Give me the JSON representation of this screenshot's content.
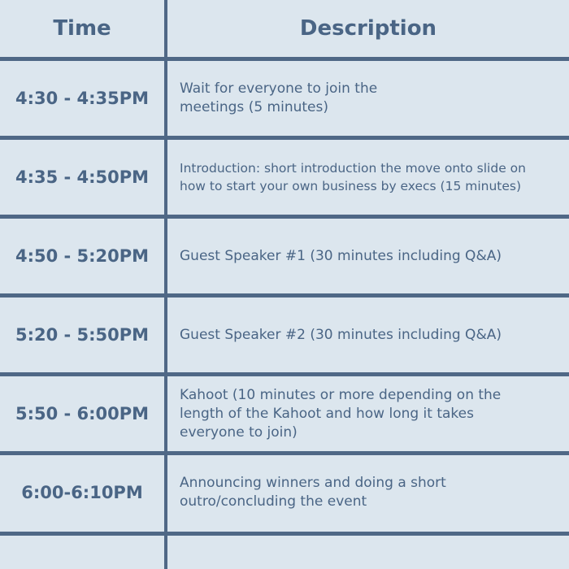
{
  "header": {
    "time_label": "Time",
    "description_label": "Description"
  },
  "rows": [
    {
      "time": "4:30 - 4:35PM",
      "description_lines": [
        "Wait for everyone to join the",
        "meetings (5 minutes)"
      ]
    },
    {
      "time": "4:35 - 4:50PM",
      "description_lines": [
        "Introduction: short introduction the move onto slide on",
        "how to start your own business by execs (15 minutes)"
      ]
    },
    {
      "time": "4:50 - 5:20PM",
      "description_lines": [
        "Guest Speaker #1 (30 minutes including Q&A)"
      ]
    },
    {
      "time": "5:20 - 5:50PM",
      "description_lines": [
        "Guest Speaker #2 (30 minutes including Q&A)"
      ]
    },
    {
      "time": "5:50 - 6:00PM",
      "description_lines": [
        "Kahoot (10 minutes or more depending on the",
        "length of the Kahoot and how long it takes",
        "everyone to join)"
      ]
    },
    {
      "time": "6:00-6:10PM",
      "description_lines": [
        "Announcing winners and doing a short",
        "outro/concluding the event"
      ]
    },
    {
      "time": "",
      "description_lines": []
    }
  ]
}
